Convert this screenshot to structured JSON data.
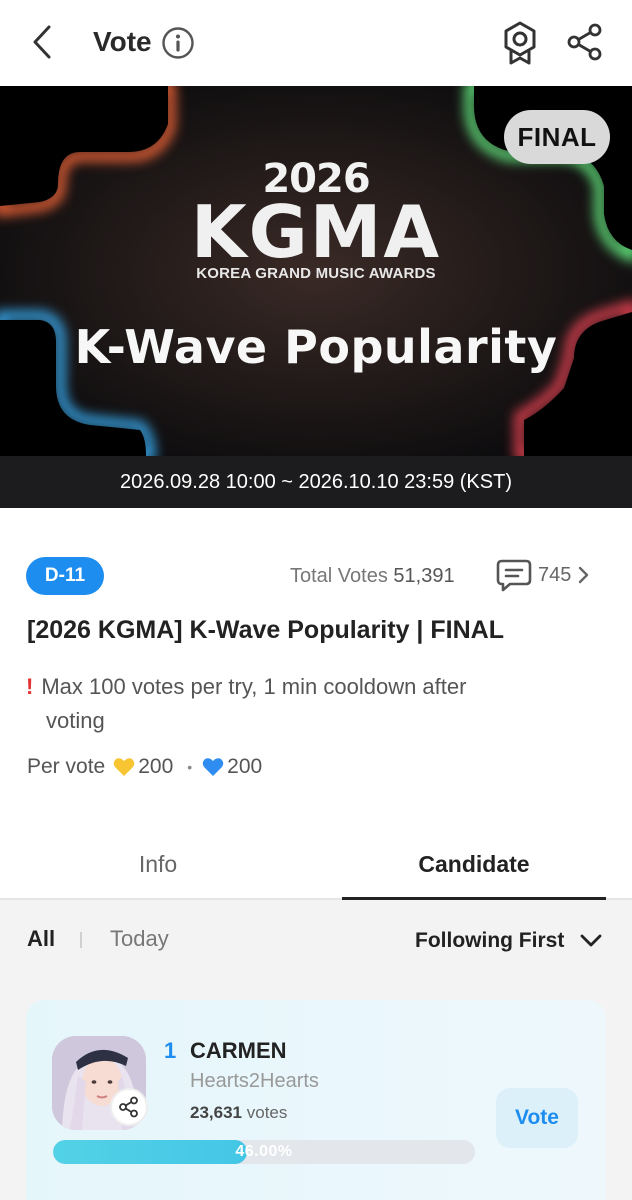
{
  "header": {
    "title": "Vote",
    "icons": [
      "chevron-left-icon",
      "info-icon",
      "badge-icon",
      "share-icon"
    ]
  },
  "banner": {
    "final_label": "FINAL",
    "year": "2026",
    "logo": "KGMA",
    "subtitle": "KOREA GRAND MUSIC AWARDS",
    "headline": "K-Wave Popularity",
    "period": "2026.09.28 10:00 ~ 2026.10.10 23:59 (KST)"
  },
  "meta": {
    "dday": "D-11",
    "total_votes_label": "Total Votes",
    "total_votes_value": "51,391",
    "comment_count": "745"
  },
  "event": {
    "title": "[2026 KGMA] K-Wave Popularity | FINAL",
    "notice_line1": "Max 100 votes per try, 1 min cooldown after",
    "notice_line2": "voting",
    "per_vote_label": "Per vote",
    "cost_gold": "200",
    "cost_blue": "200",
    "colors": {
      "gold_heart": "#f7c531",
      "blue_heart": "#2f8cf0"
    }
  },
  "tabs": [
    {
      "label": "Info",
      "active": false
    },
    {
      "label": "Candidate",
      "active": true
    }
  ],
  "filters": {
    "all": "All",
    "today": "Today",
    "sort": "Following First"
  },
  "candidates": [
    {
      "rank": "1",
      "name": "CARMEN",
      "group": "Hearts2Hearts",
      "votes_number": "23,631",
      "votes_unit": "votes",
      "percent_label": "46.00%",
      "percent": 46.0,
      "vote_button": "Vote"
    }
  ],
  "colors": {
    "accent": "#1e8df0",
    "progress": "#4ccbe6",
    "card_bg": "#e8f6fb"
  }
}
